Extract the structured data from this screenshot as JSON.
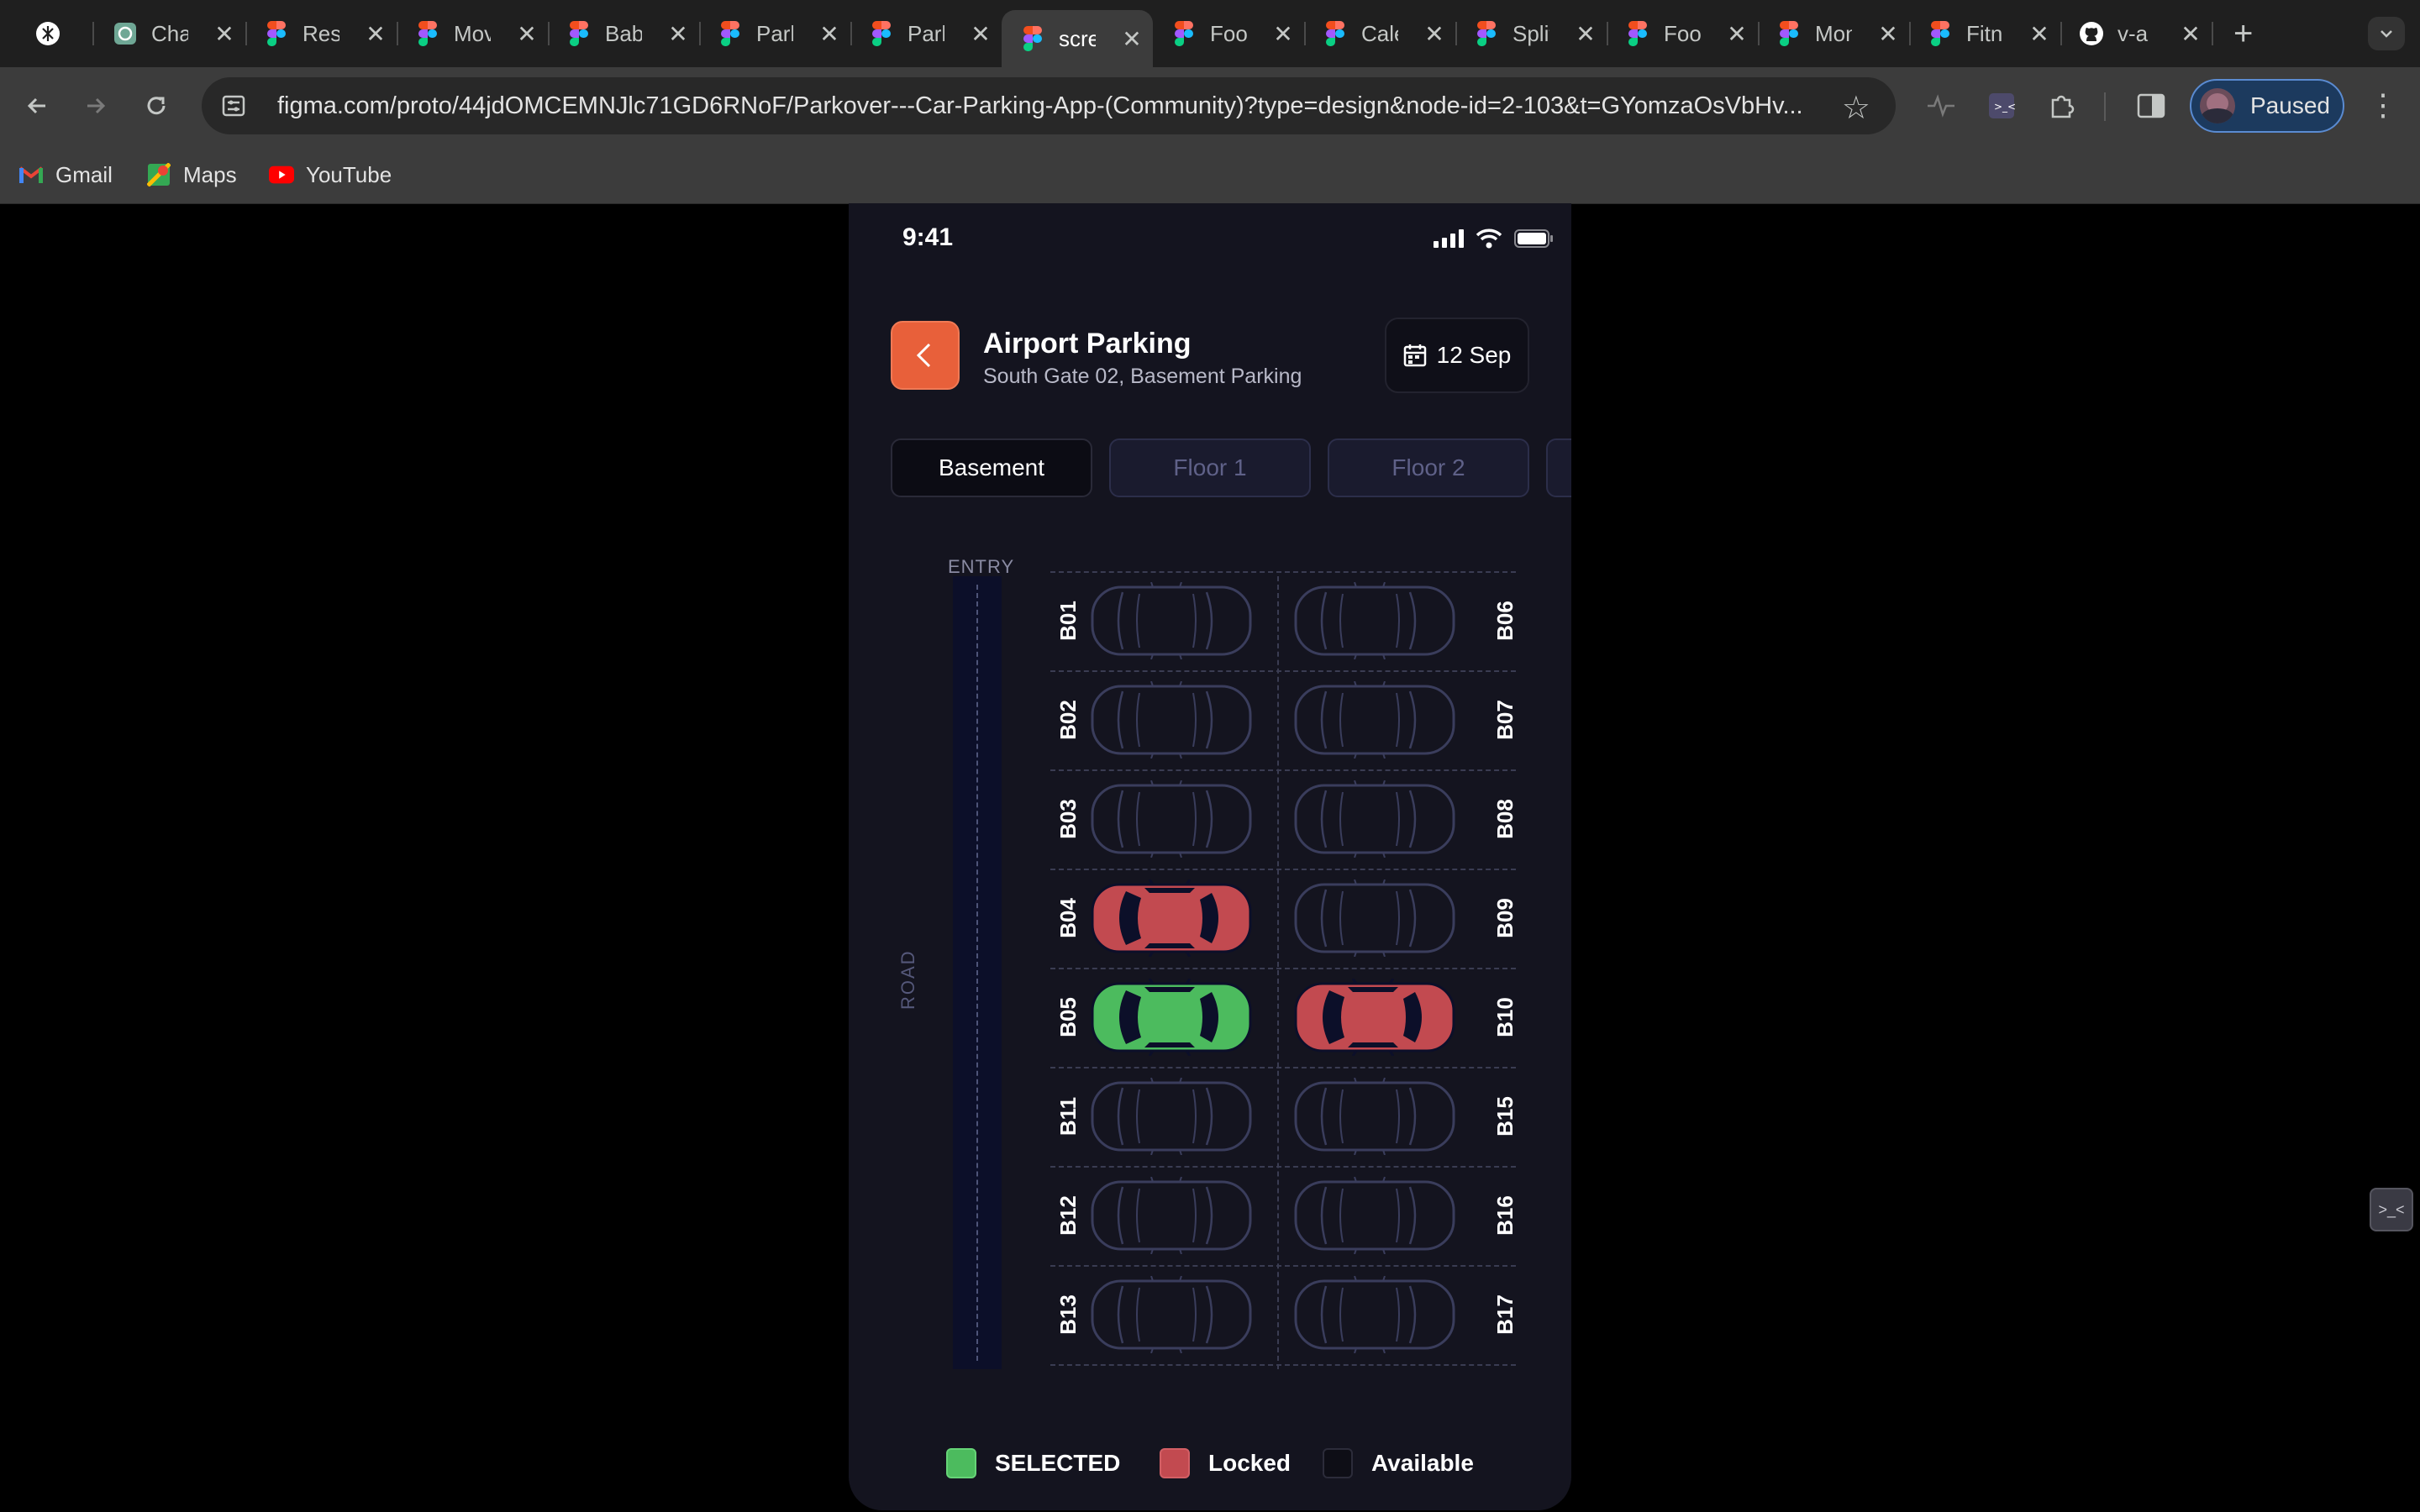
{
  "browser": {
    "tabs": [
      {
        "title": "",
        "icon": "perplexity-icon"
      },
      {
        "title": "ChatGPT",
        "icon": "chatgpt-icon"
      },
      {
        "title": "Restaurant",
        "icon": "figma-icon"
      },
      {
        "title": "Movie",
        "icon": "figma-icon"
      },
      {
        "title": "Baby",
        "icon": "figma-icon"
      },
      {
        "title": "Parking",
        "icon": "figma-icon"
      },
      {
        "title": "Parking",
        "icon": "figma-icon"
      },
      {
        "title": "screen",
        "icon": "figma-icon",
        "active": true
      },
      {
        "title": "Food",
        "icon": "figma-icon"
      },
      {
        "title": "Calendar",
        "icon": "figma-icon"
      },
      {
        "title": "Split",
        "icon": "figma-icon"
      },
      {
        "title": "Food",
        "icon": "figma-icon"
      },
      {
        "title": "Money",
        "icon": "figma-icon"
      },
      {
        "title": "Fitness",
        "icon": "figma-icon"
      },
      {
        "title": "v-a",
        "icon": "github-icon"
      }
    ],
    "url": "figma.com/proto/44jdOMCEMNJlc71GD6RNoF/Parkover---Car-Parking-App-(Community)?type=design&node-id=2-103&t=GYomzaOsVbHv...",
    "profile_label": "Paused",
    "bookmarks": [
      {
        "label": "Gmail",
        "icon": "gmail-icon"
      },
      {
        "label": "Maps",
        "icon": "maps-icon"
      },
      {
        "label": "YouTube",
        "icon": "youtube-icon"
      }
    ]
  },
  "app": {
    "status_time": "9:41",
    "title": "Airport Parking",
    "subtitle": "South Gate 02, Basement Parking",
    "date": "12 Sep",
    "floor_tabs": [
      "Basement",
      "Floor 1",
      "Floor 2",
      ""
    ],
    "active_floor": "Basement",
    "entry_label": "ENTRY",
    "road_label": "ROAD",
    "slots_left": [
      {
        "id": "B01",
        "status": "available"
      },
      {
        "id": "B02",
        "status": "available"
      },
      {
        "id": "B03",
        "status": "available"
      },
      {
        "id": "B04",
        "status": "locked"
      },
      {
        "id": "B05",
        "status": "selected"
      },
      {
        "id": "B11",
        "status": "available"
      },
      {
        "id": "B12",
        "status": "available"
      },
      {
        "id": "B13",
        "status": "available"
      }
    ],
    "slots_right": [
      {
        "id": "B06",
        "status": "available"
      },
      {
        "id": "B07",
        "status": "available"
      },
      {
        "id": "B08",
        "status": "available"
      },
      {
        "id": "B09",
        "status": "available"
      },
      {
        "id": "B10",
        "status": "locked"
      },
      {
        "id": "B15",
        "status": "available"
      },
      {
        "id": "B16",
        "status": "available"
      },
      {
        "id": "B17",
        "status": "available"
      }
    ],
    "legend": [
      {
        "label": "SELECTED",
        "key": "selected"
      },
      {
        "label": "Locked",
        "key": "locked"
      },
      {
        "label": "Available",
        "key": "available"
      }
    ],
    "colors": {
      "accent": "#e8603a",
      "selected": "#4cbb5e",
      "locked": "#c24a50",
      "available_outline": "#3a3d5c",
      "background": "#14141f"
    }
  }
}
